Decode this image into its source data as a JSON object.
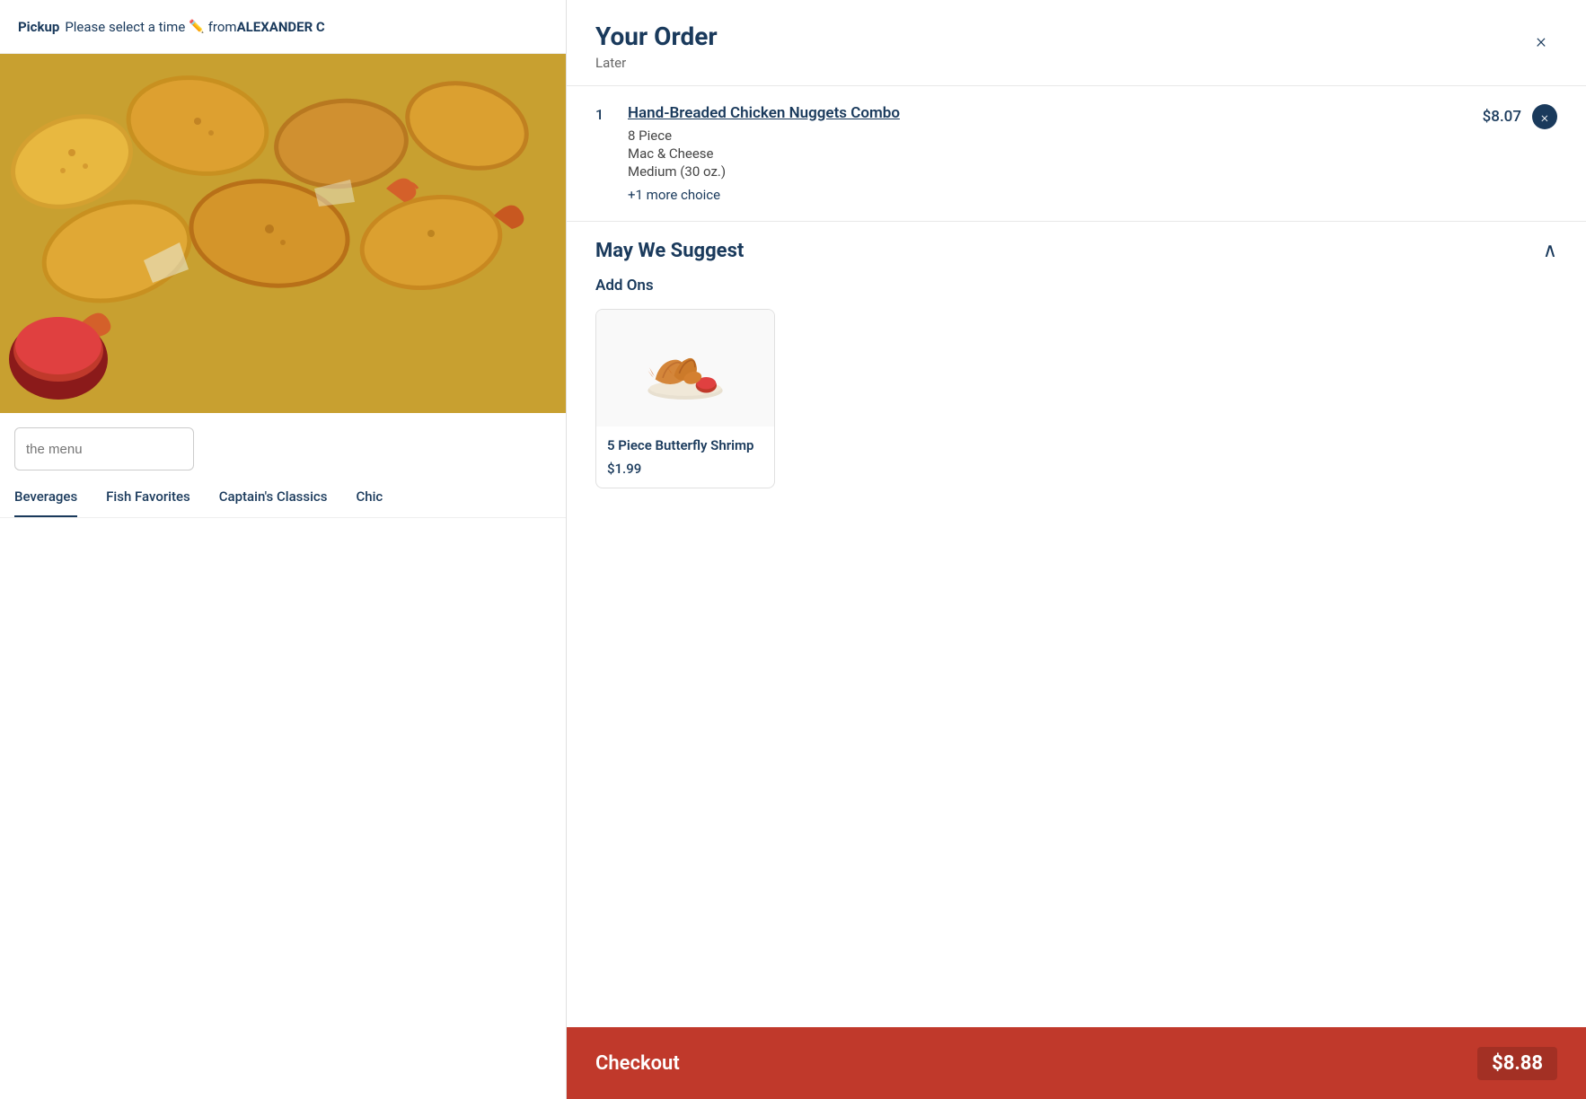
{
  "header": {
    "pickup_label": "Pickup",
    "please_select": "Please select a time",
    "pencil": "✏️",
    "from_text": "from",
    "store_name": "ALEXANDER C"
  },
  "food_image": {
    "alt": "Fried chicken nuggets and shrimp"
  },
  "search": {
    "placeholder": "the menu",
    "value": "the menu"
  },
  "menu_nav": {
    "items": [
      {
        "label": "Beverages"
      },
      {
        "label": "Fish Favorites"
      },
      {
        "label": "Captain's Classics"
      },
      {
        "label": "Chic"
      }
    ]
  },
  "order": {
    "title": "Your Order",
    "subtitle": "Later",
    "close_label": "×"
  },
  "order_item": {
    "quantity": "1",
    "name": "Hand-Breaded Chicken Nuggets Combo",
    "price": "$8.07",
    "customizations": [
      "8 Piece",
      "Mac & Cheese",
      "Medium (30 oz.)"
    ],
    "more_choices": "+1 more choice",
    "remove_icon": "×"
  },
  "suggest": {
    "title": "May We Suggest",
    "chevron": "∧",
    "addons_label": "Add Ons",
    "items": [
      {
        "name": "5 Piece Butterfly Shrimp",
        "price": "$1.99"
      }
    ]
  },
  "checkout": {
    "label": "Checkout",
    "price": "$8.88"
  }
}
